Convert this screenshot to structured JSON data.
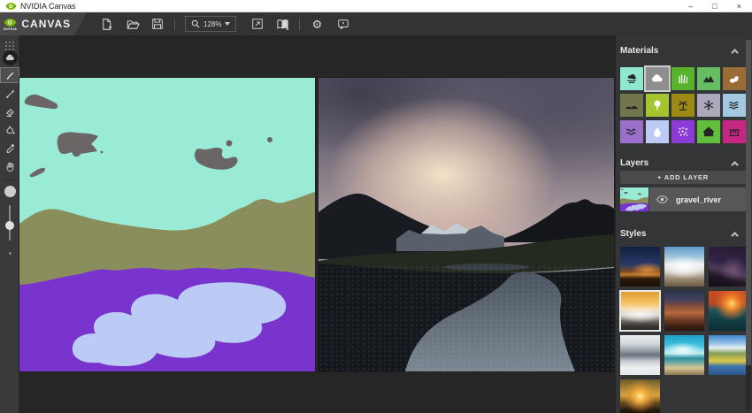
{
  "window": {
    "title": "NVIDIA Canvas",
    "controls": {
      "minimize": "–",
      "maximize": "□",
      "close": "×"
    }
  },
  "toolbar": {
    "logo_text": "NVIDIA",
    "brand": "CANVAS",
    "zoom_value": "128%",
    "icons": [
      "new-project-icon",
      "open-project-icon",
      "save-project-icon",
      "zoom-icon",
      "fullscreen-icon",
      "side-by-side-view-icon",
      "settings-gear-icon",
      "feedback-icon"
    ]
  },
  "tools": [
    "drag-handle",
    "active-material-preview",
    "brush-tool",
    "line-tool",
    "eraser-tool",
    "fill-tool",
    "color-picker-tool",
    "pan-tool",
    "brush-size-preview",
    "brush-size-slider"
  ],
  "materials": {
    "header": "Materials",
    "items": [
      {
        "name": "sky",
        "color": "#8FE7D0",
        "icon": "sky-icon",
        "icon_light": false,
        "selected": false
      },
      {
        "name": "cloud",
        "color": "#8E8E8E",
        "icon": "cloud-icon",
        "icon_light": true,
        "selected": true
      },
      {
        "name": "grass",
        "color": "#57B42A",
        "icon": "grass-icon",
        "icon_light": true,
        "selected": false
      },
      {
        "name": "mountain",
        "color": "#64BE61",
        "icon": "mountain-icon",
        "icon_light": false,
        "selected": false
      },
      {
        "name": "rock",
        "color": "#9C6C36",
        "icon": "rock-icon",
        "icon_light": true,
        "selected": false
      },
      {
        "name": "hill",
        "color": "#71774B",
        "icon": "hill-icon",
        "icon_light": false,
        "selected": false
      },
      {
        "name": "tree",
        "color": "#A3C52F",
        "icon": "tree-icon",
        "icon_light": true,
        "selected": false
      },
      {
        "name": "palm",
        "color": "#9D8A14",
        "icon": "palm-icon",
        "icon_light": false,
        "selected": false
      },
      {
        "name": "snow",
        "color": "#ACA9BC",
        "icon": "snow-icon",
        "icon_light": false,
        "selected": false
      },
      {
        "name": "sea",
        "color": "#A3C9E2",
        "icon": "sea-icon",
        "icon_light": false,
        "selected": false
      },
      {
        "name": "river",
        "color": "#9C6FCB",
        "icon": "river-icon",
        "icon_light": false,
        "selected": false
      },
      {
        "name": "water",
        "color": "#BCCBF5",
        "icon": "water-icon",
        "icon_light": true,
        "selected": false
      },
      {
        "name": "fog",
        "color": "#8D3BD6",
        "icon": "fog-icon",
        "icon_light": true,
        "selected": false
      },
      {
        "name": "house",
        "color": "#62BE3D",
        "icon": "house-icon",
        "icon_light": false,
        "selected": false
      },
      {
        "name": "bridge",
        "color": "#C52782",
        "icon": "bridge-icon",
        "icon_light": false,
        "selected": false
      }
    ]
  },
  "layers": {
    "header": "Layers",
    "add_button": "+ ADD LAYER",
    "items": [
      {
        "name": "gravel_river",
        "visible": true,
        "selected": true
      }
    ]
  },
  "styles": {
    "header": "Styles",
    "items": [
      {
        "name": "desert-night",
        "selected": false
      },
      {
        "name": "snowy-peak-clouds",
        "selected": false
      },
      {
        "name": "starry-night-mountain",
        "selected": false
      },
      {
        "name": "sunset-fog-valley",
        "selected": true
      },
      {
        "name": "jagged-peaks-sunset",
        "selected": false
      },
      {
        "name": "ocean-sunset",
        "selected": false
      },
      {
        "name": "misty-mountains",
        "selected": false
      },
      {
        "name": "tropical-beach",
        "selected": false
      },
      {
        "name": "alpine-lake",
        "selected": false
      },
      {
        "name": "sea-sunrise",
        "selected": false
      }
    ]
  },
  "canvas": {
    "segmentation": {
      "sky": "#9AEBD5",
      "cloud": "#6B6666",
      "hill": "#8A8E5C",
      "water": "#7A34CE",
      "river": "#BCCBF5"
    }
  }
}
